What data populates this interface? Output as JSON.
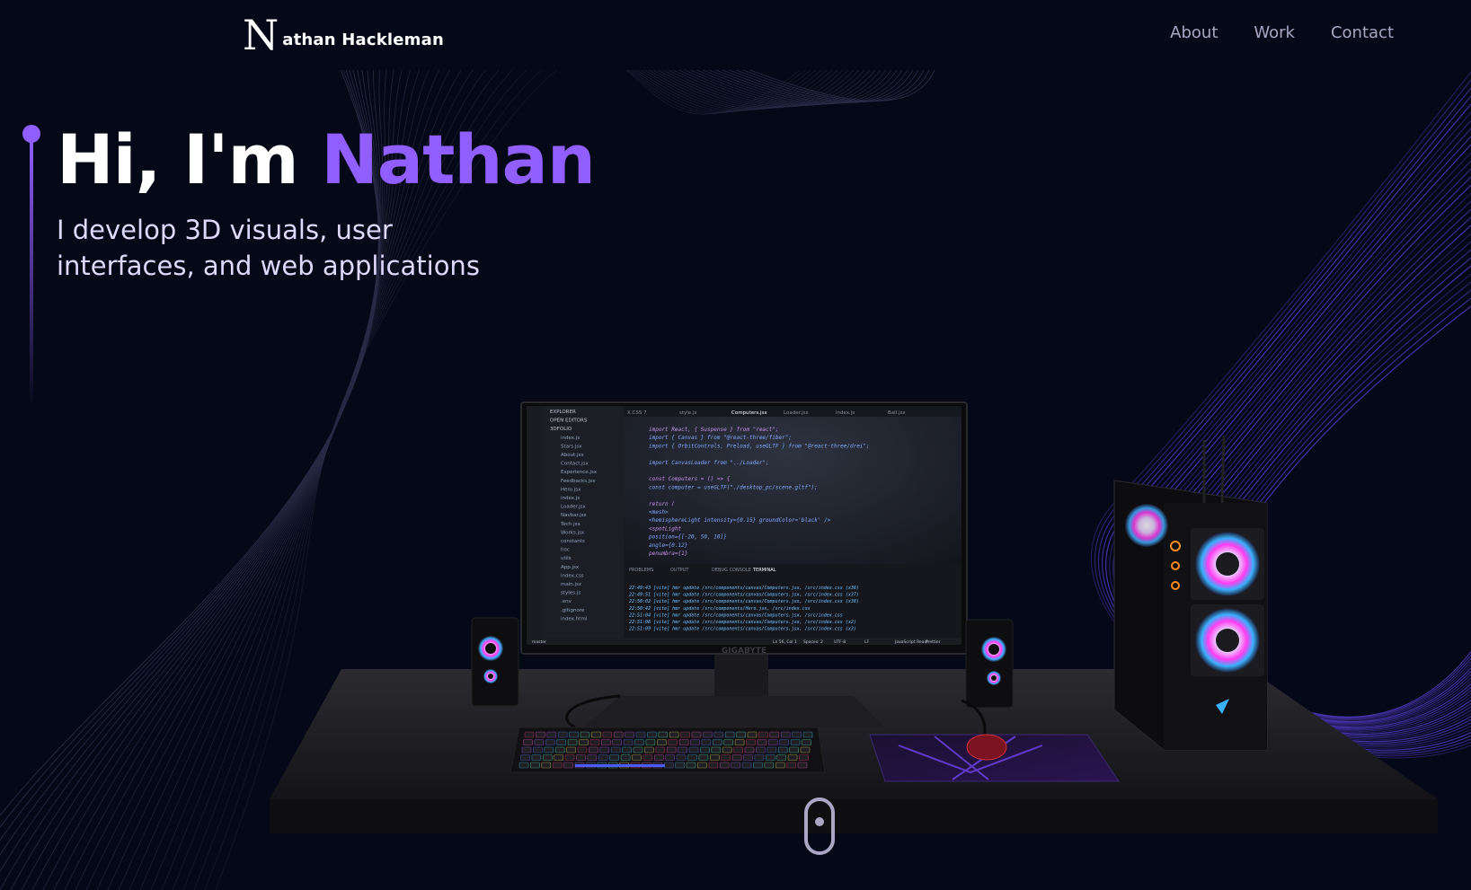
{
  "nav": {
    "logo_mark": "N",
    "logo_text": "athan Hackleman",
    "links": [
      {
        "label": "About"
      },
      {
        "label": "Work"
      },
      {
        "label": "Contact"
      }
    ]
  },
  "hero": {
    "title_prefix": "Hi, I'm",
    "title_name": "Nathan",
    "subtitle": "I develop 3D visuals, user interfaces, and web applications"
  },
  "colors": {
    "background": "#050816",
    "accent": "#915eff",
    "nav_text": "#aaa6c3",
    "subtitle_text": "#dfd9ff"
  },
  "scene": {
    "monitor_brand": "GIGABYTE",
    "editor_tabs": [
      "X.CSS 7",
      "style.js",
      "Computers.jsx",
      "Loader.jsx",
      "index.js",
      "Ball.jsx"
    ],
    "editor_code": [
      "import React, { Suspense } from \"react\";",
      "import { Canvas } from \"@react-three/fiber\";",
      "import { OrbitControls, Preload, useGLTF } from \"@react-three/drei\";",
      "",
      "import CanvasLoader from \"../Loader\";",
      "",
      "const Computers = () => {",
      "  const computer = useGLTF(\"./desktop_pc/scene.gltf\");",
      "",
      "  return (",
      "    <mesh>",
      "      <hemisphereLight intensity={0.15} groundColor='black' />",
      "      <spotLight",
      "        position={[-20, 50, 10]}",
      "        angle={0.12}",
      "        penumbra={1}"
    ],
    "explorer_files": [
      "EXPLORER",
      "OPEN EDITORS",
      "3DFOLIO",
      "index.js",
      "Stars.jsx",
      "About.jsx",
      "Contact.jsx",
      "Experience.jsx",
      "Feedbacks.jsx",
      "Hero.jsx",
      "index.js",
      "Loader.jsx",
      "Navbar.jsx",
      "Tech.jsx",
      "Works.jsx",
      "constants",
      "hoc",
      "utils",
      "App.jsx",
      "index.css",
      "main.jsx",
      "styles.js",
      ".env",
      ".gitignore",
      "index.html"
    ],
    "terminal_tabs": [
      "PROBLEMS",
      "OUTPUT",
      "DEBUG CONSOLE",
      "TERMINAL"
    ],
    "terminal_lines": [
      "22:49:43 [vite] hmr update /src/components/canvas/Computers.jsx, /src/index.css (x36)",
      "22:49:51 [vite] hmr update /src/components/canvas/Computers.jsx, /src/index.css (x37)",
      "22:50:02 [vite] hmr update /src/components/canvas/Computers.jsx, /src/index.css (x38)",
      "22:50:42 [vite] hmr update /src/components/Hero.jsx, /src/index.css",
      "22:51:04 [vite] hmr update /src/components/canvas/Computers.jsx, /src/index.css",
      "22:51:06 [vite] hmr update /src/components/canvas/Computers.jsx, /src/index.css (x2)",
      "22:51:09 [vite] hmr update /src/components/canvas/Computers.jsx, /src/index.css (x3)"
    ],
    "status_bar": [
      "master",
      "Ln 56, Col 1",
      "Spaces: 2",
      "UTF-8",
      "LF",
      "JavaScript React",
      "Prettier"
    ]
  }
}
